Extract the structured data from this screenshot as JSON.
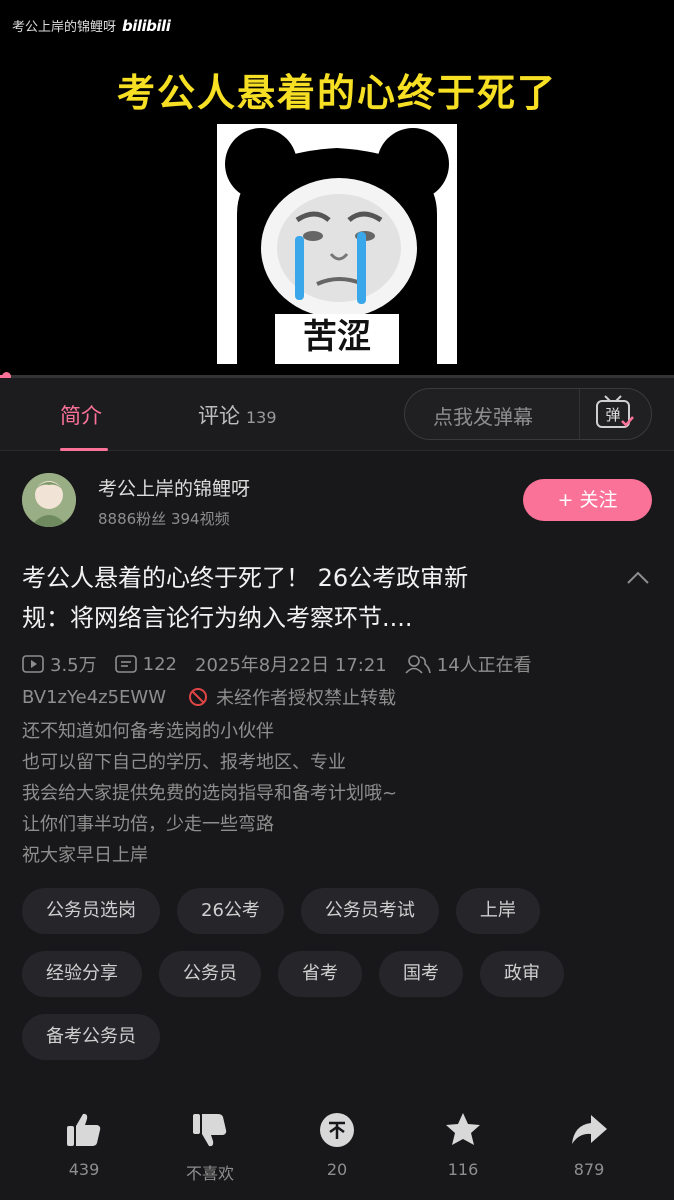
{
  "video": {
    "watermark_user": "考公上岸的锦鲤呀",
    "watermark_brand": "bilibili",
    "overlay_title": "考公人悬着的心终于死了",
    "meme_caption": "苦涩",
    "progress_fraction": 0.01
  },
  "tabs": {
    "intro": "简介",
    "comments": "评论",
    "comments_count": "139"
  },
  "danmu": {
    "placeholder": "点我发弹幕",
    "button_glyph": "弹"
  },
  "uploader": {
    "name": "考公上岸的锦鲤呀",
    "stats": "8886粉丝  394视频",
    "follow_label": "+ 关注"
  },
  "video_info": {
    "title_line1": "考公人悬着的心终于死了！ 26公考政审新",
    "title_line2": "规：将网络言论行为纳入考察环节....",
    "views": "3.5万",
    "danmaku_count": "122",
    "datetime": "2025年8月22日 17:21",
    "watching": "14人正在看",
    "bvid": "BV1zYe4z5EWW",
    "no_repost": "未经作者授权禁止转载",
    "description": [
      "还不知道如何备考选岗的小伙伴",
      "也可以留下自己的学历、报考地区、专业",
      "我会给大家提供免费的选岗指导和备考计划哦~",
      "让你们事半功倍，少走一些弯路",
      "祝大家早日上岸"
    ]
  },
  "tags": [
    [
      "公务员选岗",
      "26公考",
      "公务员考试",
      "上岸"
    ],
    [
      "经验分享",
      "公务员",
      "省考",
      "国考",
      "政审"
    ],
    [
      "备考公务员"
    ]
  ],
  "actions": {
    "like": "439",
    "dislike": "不喜欢",
    "coin": "20",
    "favorite": "116",
    "share": "879"
  },
  "colors": {
    "accent": "#fb7299",
    "title_yellow": "#f7e024",
    "background": "#18181a"
  }
}
